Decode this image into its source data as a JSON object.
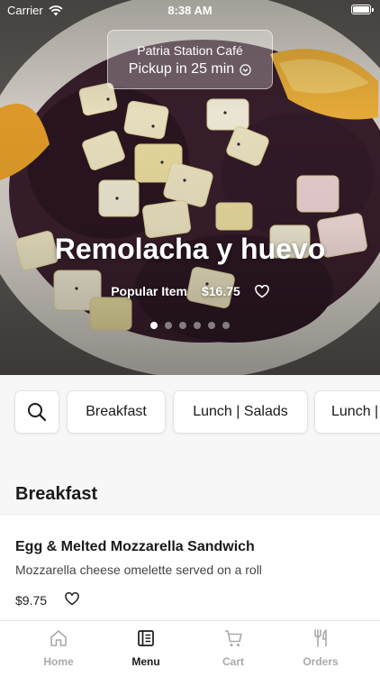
{
  "status_bar": {
    "carrier": "Carrier",
    "time": "8:38 AM"
  },
  "store": {
    "name": "Patria Station Café",
    "pickup": "Pickup in 25 min"
  },
  "hero": {
    "title": "Remolacha y huevo",
    "tag": "Popular Item",
    "price": "$16.75",
    "slides": 6,
    "active_slide": 1
  },
  "categories": {
    "search_icon": "search-icon",
    "items": [
      "Breakfast",
      "Lunch | Salads",
      "Lunch |"
    ]
  },
  "section": {
    "title": "Breakfast"
  },
  "menu_items": [
    {
      "name": "Egg & Melted Mozzarella Sandwich",
      "description": "Mozzarella cheese omelette served on a roll",
      "price": "$9.75"
    }
  ],
  "tabbar": {
    "tabs": [
      {
        "label": "Home",
        "icon": "home-icon"
      },
      {
        "label": "Menu",
        "icon": "menu-book-icon"
      },
      {
        "label": "Cart",
        "icon": "cart-icon"
      },
      {
        "label": "Orders",
        "icon": "fork-knife-icon"
      }
    ],
    "active": "Menu"
  },
  "colors": {
    "accent": "#1a1a1a",
    "inactive": "#a9a9a9",
    "background": "#f7f7f7"
  }
}
